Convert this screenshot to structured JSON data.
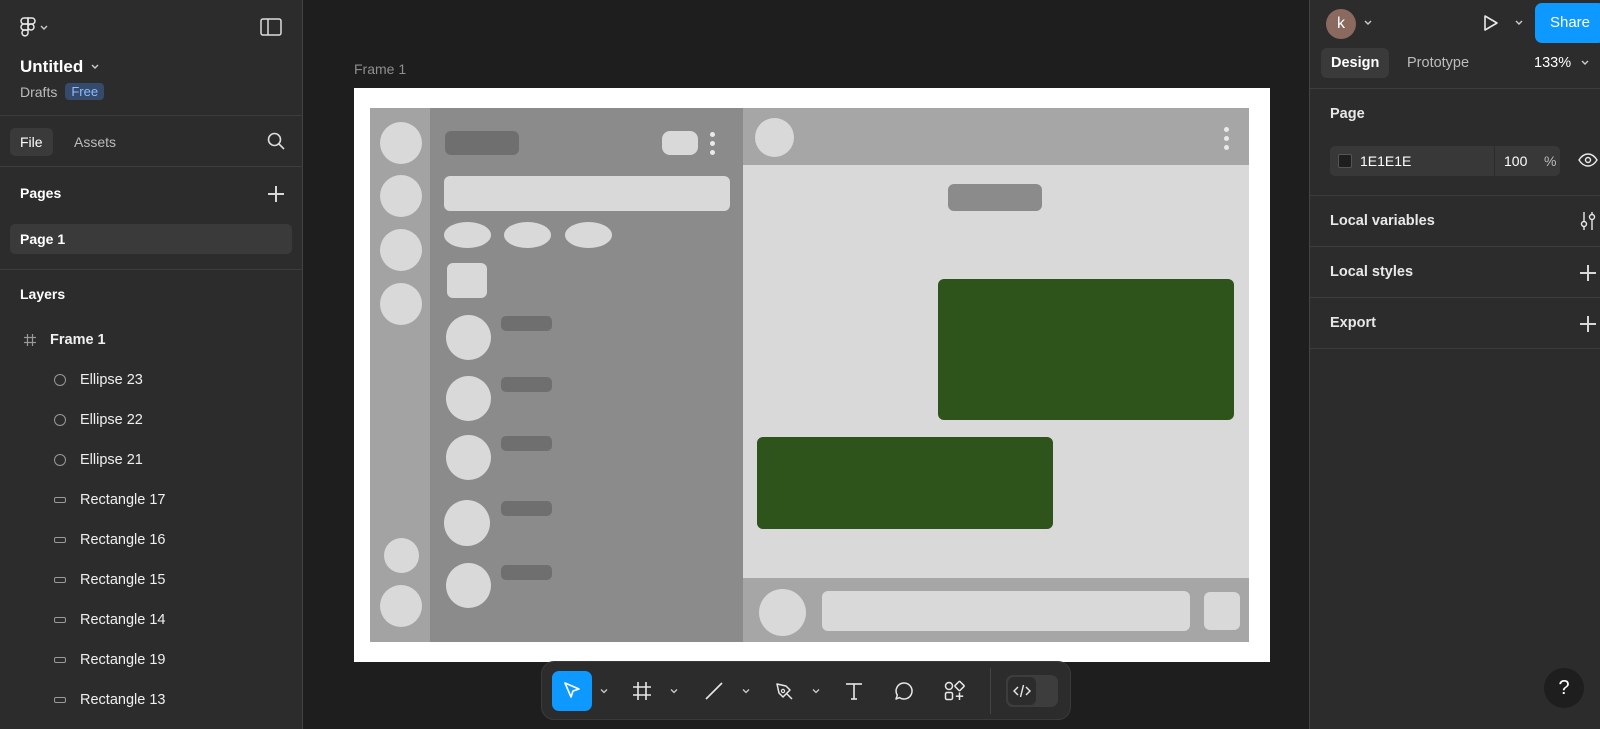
{
  "file": {
    "title": "Untitled",
    "location": "Drafts",
    "plan_badge": "Free"
  },
  "left_tabs": {
    "file": "File",
    "assets": "Assets"
  },
  "pages": {
    "header": "Pages",
    "items": [
      "Page 1"
    ]
  },
  "layers": {
    "header": "Layers",
    "frame": "Frame 1",
    "children": [
      {
        "name": "Ellipse 23",
        "icon": "ellipse-icon"
      },
      {
        "name": "Ellipse 22",
        "icon": "ellipse-icon"
      },
      {
        "name": "Ellipse 21",
        "icon": "ellipse-icon"
      },
      {
        "name": "Rectangle 17",
        "icon": "rectangle-icon"
      },
      {
        "name": "Rectangle 16",
        "icon": "rectangle-icon"
      },
      {
        "name": "Rectangle 15",
        "icon": "rectangle-icon"
      },
      {
        "name": "Rectangle 14",
        "icon": "rectangle-icon"
      },
      {
        "name": "Rectangle 19",
        "icon": "rectangle-icon"
      },
      {
        "name": "Rectangle 13",
        "icon": "rectangle-icon"
      }
    ]
  },
  "canvas": {
    "frame_label": "Frame 1",
    "background": "#1e1e1e",
    "accent_green": "#2e531b"
  },
  "toolbar": {
    "tools": [
      "move-tool",
      "frame-tool",
      "line-tool",
      "pen-tool",
      "text-tool",
      "comment-tool",
      "actions-tool"
    ],
    "active_tool": "move-tool",
    "dev_mode": "off"
  },
  "right": {
    "avatar_initial": "k",
    "share_label": "Share",
    "tabs": {
      "design": "Design",
      "prototype": "Prototype"
    },
    "zoom": "133%",
    "page_section": "Page",
    "page_color": "1E1E1E",
    "page_opacity": "100",
    "page_opacity_unit": "%",
    "local_variables": "Local variables",
    "local_styles": "Local styles",
    "export": "Export",
    "help": "?"
  },
  "colors": {
    "accent": "#0d99ff",
    "panel": "#2c2c2c"
  }
}
